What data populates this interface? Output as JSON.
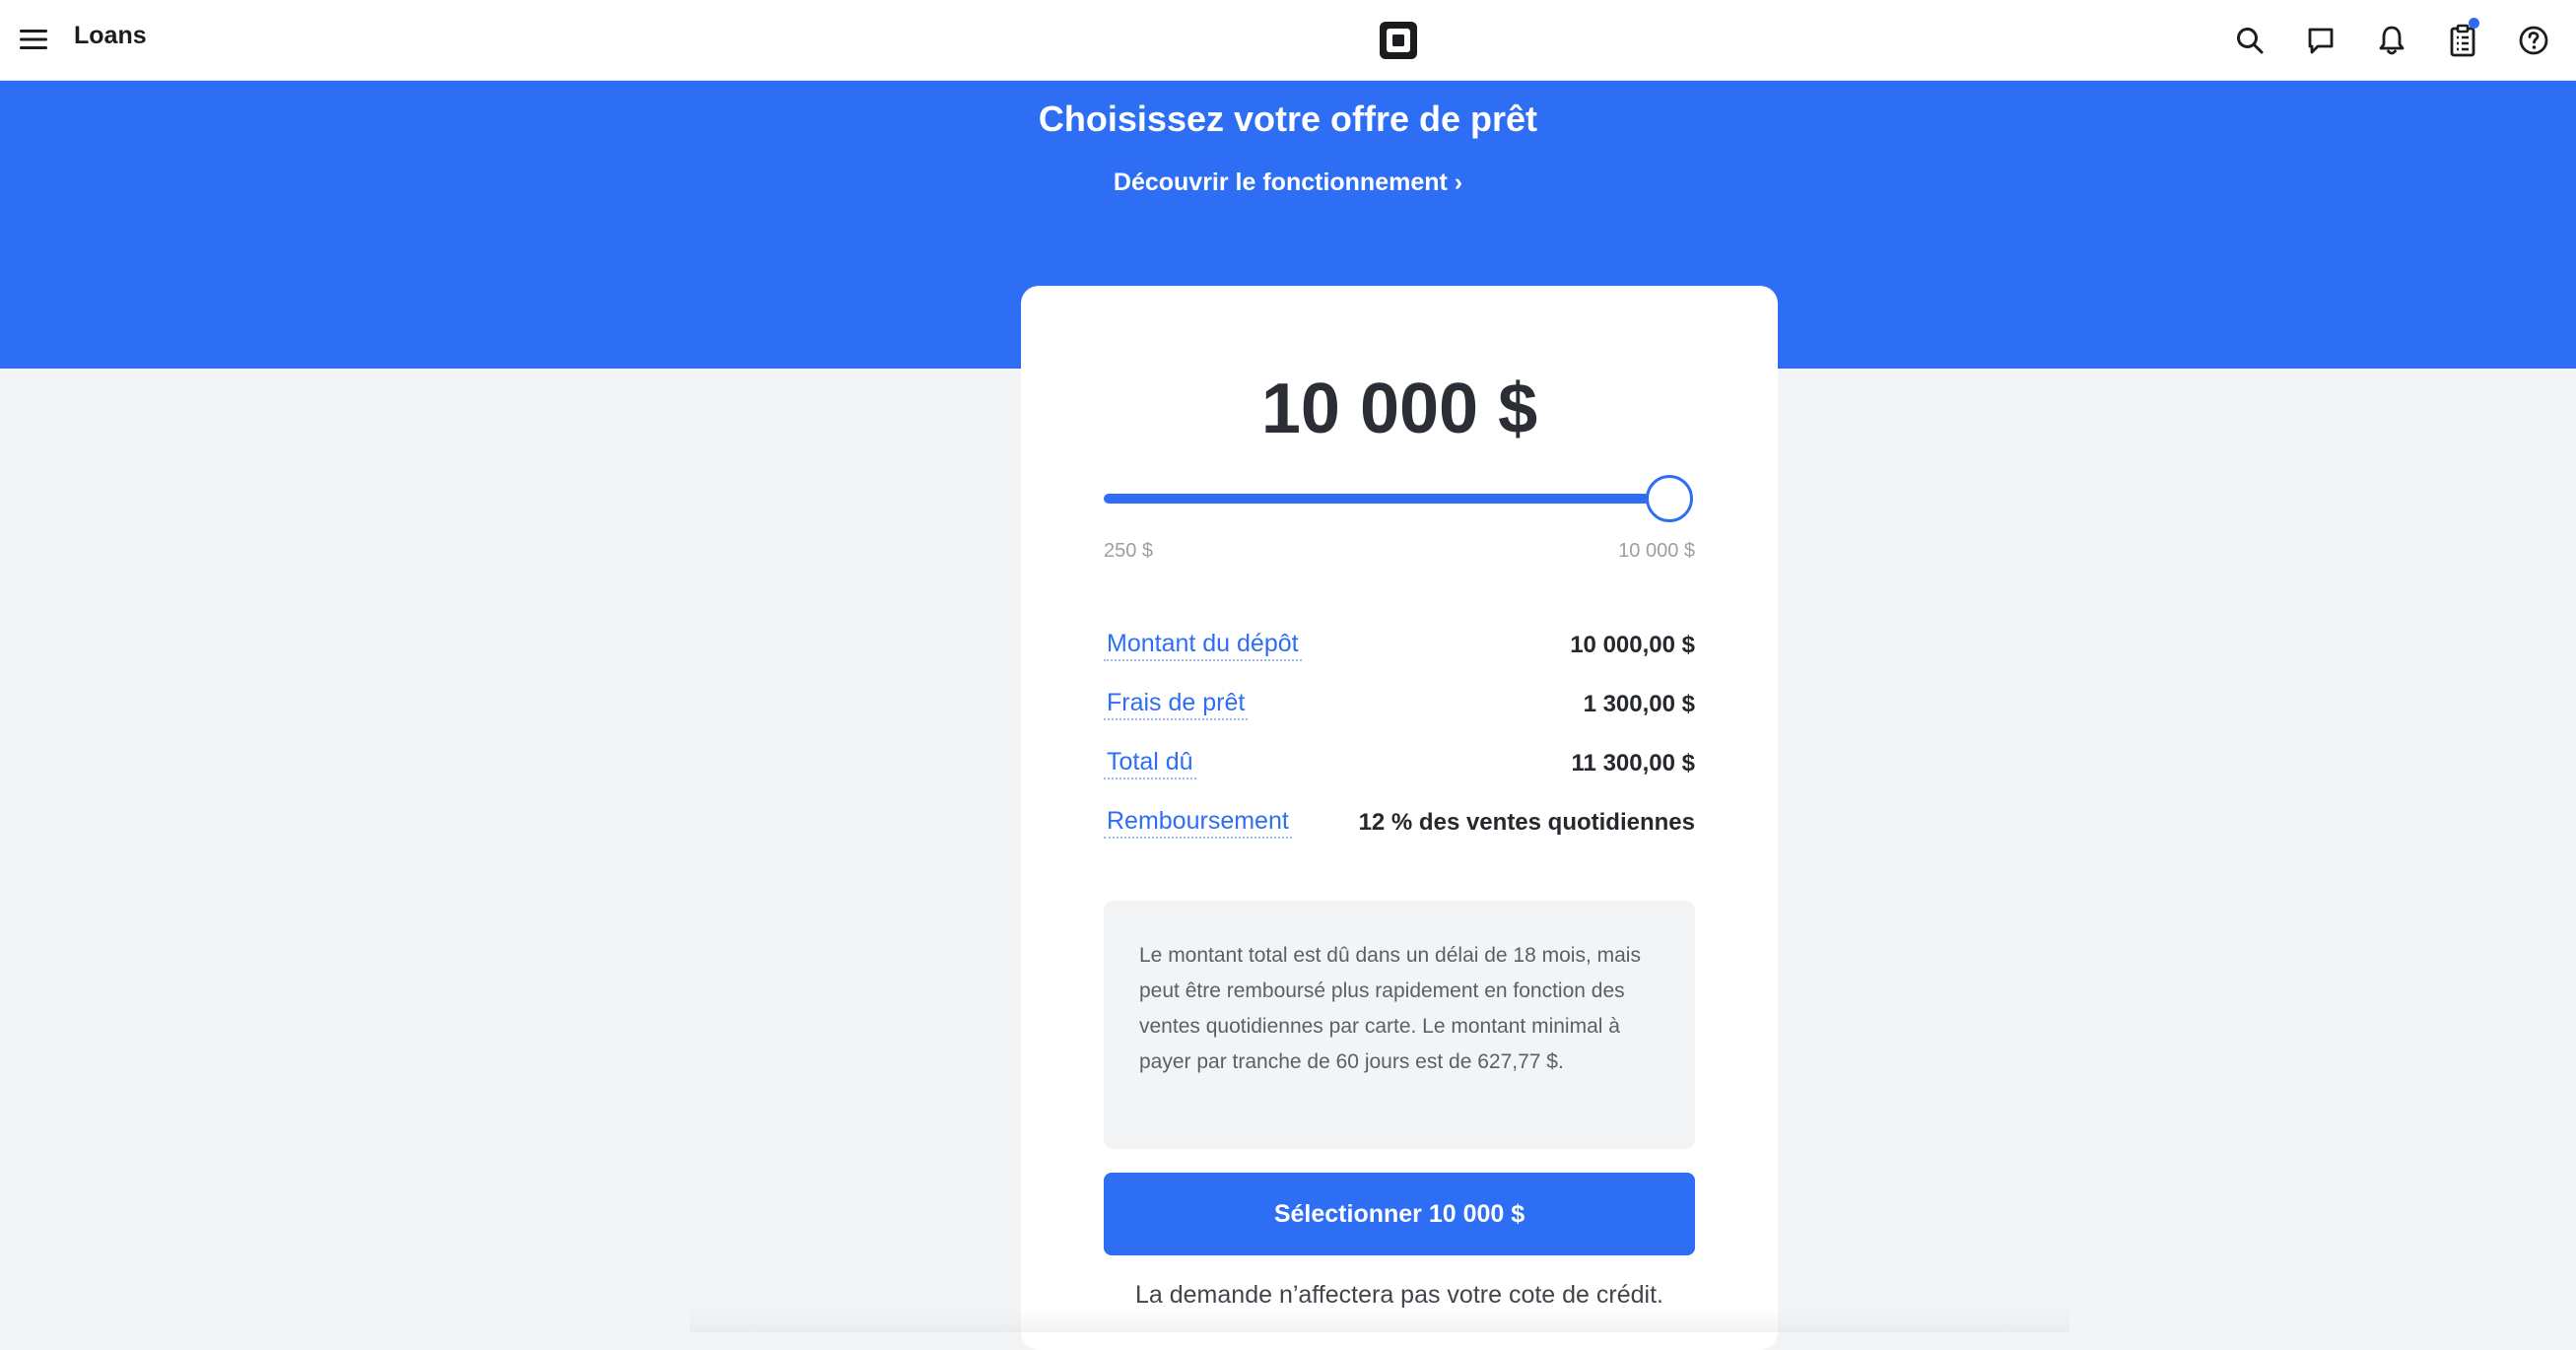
{
  "app": {
    "title": "Loans"
  },
  "icons": {
    "menu": "hamburger-menu-icon",
    "logo": "square-logo-icon",
    "search": "search-icon",
    "messages": "chat-bubble-icon",
    "notifications": "bell-icon",
    "clipboard": "clipboard-list-icon",
    "help": "question-circle-icon"
  },
  "colors": {
    "brand_blue": "#2e6ef4",
    "page_bg": "#f3f4f6",
    "notification_dot": "#2c6bf2"
  },
  "banner": {
    "title": "Choisissez votre offre de prêt",
    "link": "Découvrir le fonctionnement ›"
  },
  "offer": {
    "amount": "10 000 $",
    "slider": {
      "min_label": "250 $",
      "max_label": "10 000 $",
      "min": 250,
      "max": 10000,
      "value": 10000
    },
    "details": [
      {
        "label": "Montant du dépôt",
        "value": "10 000,00 $"
      },
      {
        "label": "Frais de prêt",
        "value": "1 300,00 $"
      },
      {
        "label": "Total dû",
        "value": "11 300,00 $"
      },
      {
        "label": "Remboursement",
        "value": "12 % des ventes quotidiennes"
      }
    ],
    "info": "Le montant total est dû dans un délai de 18 mois, mais peut être remboursé plus rapidement en fonction des ventes quotidiennes par carte. Le montant minimal à payer par tranche de 60 jours est de 627,77 $.",
    "select_button": "Sélectionner 10 000 $",
    "disclaimer": "La demande n’affectera pas votre cote de crédit."
  }
}
